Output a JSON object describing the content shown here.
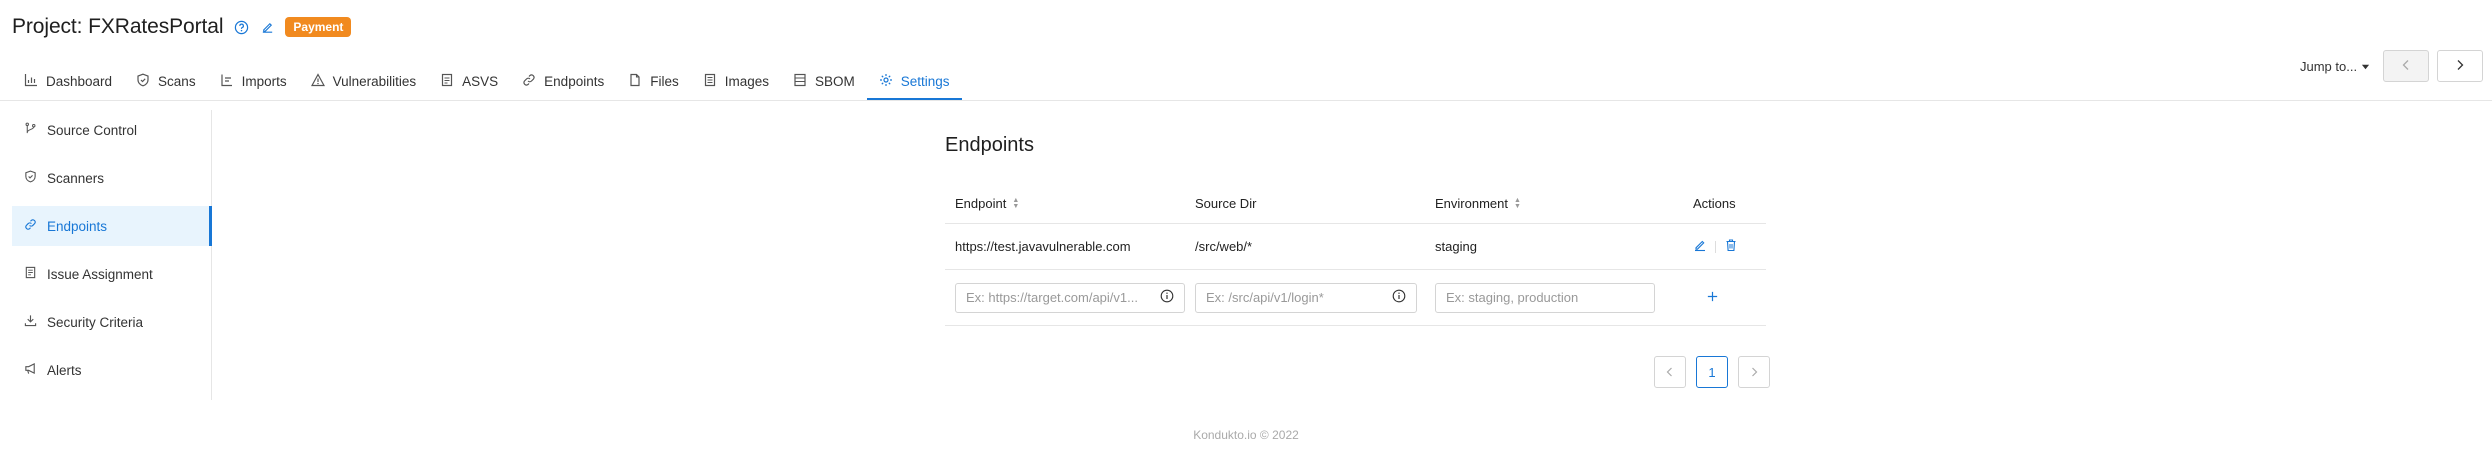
{
  "header": {
    "title": "Project: FXRatesPortal",
    "badge": "Payment",
    "icons": [
      "help-circle-icon",
      "edit-icon"
    ]
  },
  "tabs": [
    {
      "label": "Dashboard",
      "icon": "bar-chart-icon"
    },
    {
      "label": "Scans",
      "icon": "shield-icon"
    },
    {
      "label": "Imports",
      "icon": "import-icon"
    },
    {
      "label": "Vulnerabilities",
      "icon": "warning-icon"
    },
    {
      "label": "ASVS",
      "icon": "document-icon"
    },
    {
      "label": "Endpoints",
      "icon": "link-icon"
    },
    {
      "label": "Files",
      "icon": "file-icon"
    },
    {
      "label": "Images",
      "icon": "image-icon"
    },
    {
      "label": "SBOM",
      "icon": "list-icon"
    },
    {
      "label": "Settings",
      "icon": "gear-icon",
      "active": true
    }
  ],
  "jump": {
    "label": "Jump to..."
  },
  "sidebar": {
    "items": [
      {
        "label": "Source Control",
        "icon": "branch-icon"
      },
      {
        "label": "Scanners",
        "icon": "shield-icon"
      },
      {
        "label": "Endpoints",
        "icon": "link-icon",
        "active": true
      },
      {
        "label": "Issue Assignment",
        "icon": "assignment-icon"
      },
      {
        "label": "Security Criteria",
        "icon": "criteria-icon"
      },
      {
        "label": "Alerts",
        "icon": "megaphone-icon"
      }
    ]
  },
  "main": {
    "title": "Endpoints",
    "columns": [
      "Endpoint",
      "Source Dir",
      "Environment",
      "Actions"
    ],
    "rows": [
      {
        "endpoint": "https://test.javavulnerable.com",
        "source_dir": "/src/web/*",
        "environment": "staging"
      }
    ],
    "new_row": {
      "endpoint_placeholder": "Ex: https://target.com/api/v1...",
      "source_dir_placeholder": "Ex: /src/api/v1/login*",
      "environment_placeholder": "Ex: staging, production"
    },
    "pagination": {
      "current": "1"
    }
  },
  "footer": {
    "text": "Kondukto.io © 2022"
  },
  "colors": {
    "accent": "#1877d6",
    "badge": "#f18a1f"
  }
}
